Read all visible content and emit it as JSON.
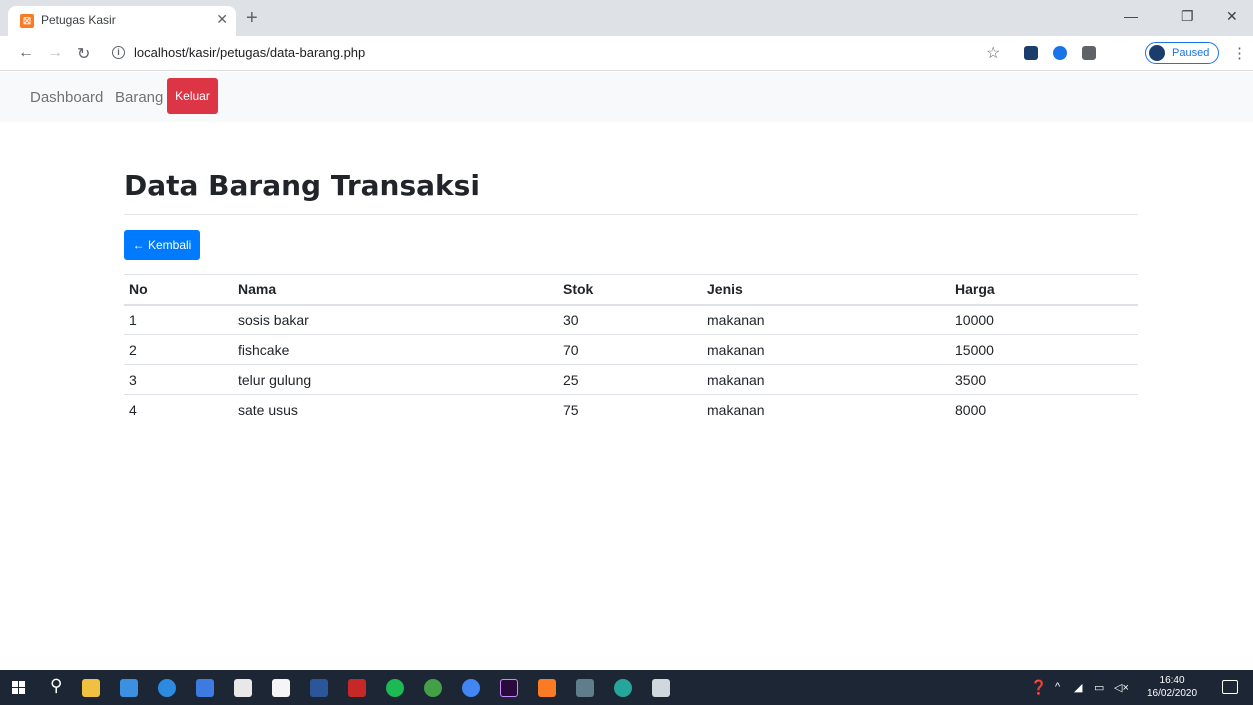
{
  "browser": {
    "tab_title": "Petugas Kasir",
    "tab_favicon": "xampp-icon",
    "url": "localhost/kasir/petugas/data-barang.php",
    "profile_status": "Paused"
  },
  "nav": {
    "dashboard": "Dashboard",
    "barang": "Barang",
    "keluar": "Keluar"
  },
  "page": {
    "title": "Data Barang Transaksi",
    "back_button": "← Kembali"
  },
  "table": {
    "headers": [
      "No",
      "Nama",
      "Stok",
      "Jenis",
      "Harga"
    ],
    "rows": [
      [
        "1",
        "sosis bakar",
        "30",
        "makanan",
        "10000"
      ],
      [
        "2",
        "fishcake",
        "70",
        "makanan",
        "15000"
      ],
      [
        "3",
        "telur gulung",
        "25",
        "makanan",
        "3500"
      ],
      [
        "4",
        "sate usus",
        "75",
        "makanan",
        "8000"
      ]
    ]
  },
  "taskbar": {
    "time": "16:40",
    "date": "16/02/2020"
  },
  "colors": {
    "danger": "#dc3545",
    "primary": "#007bff"
  }
}
